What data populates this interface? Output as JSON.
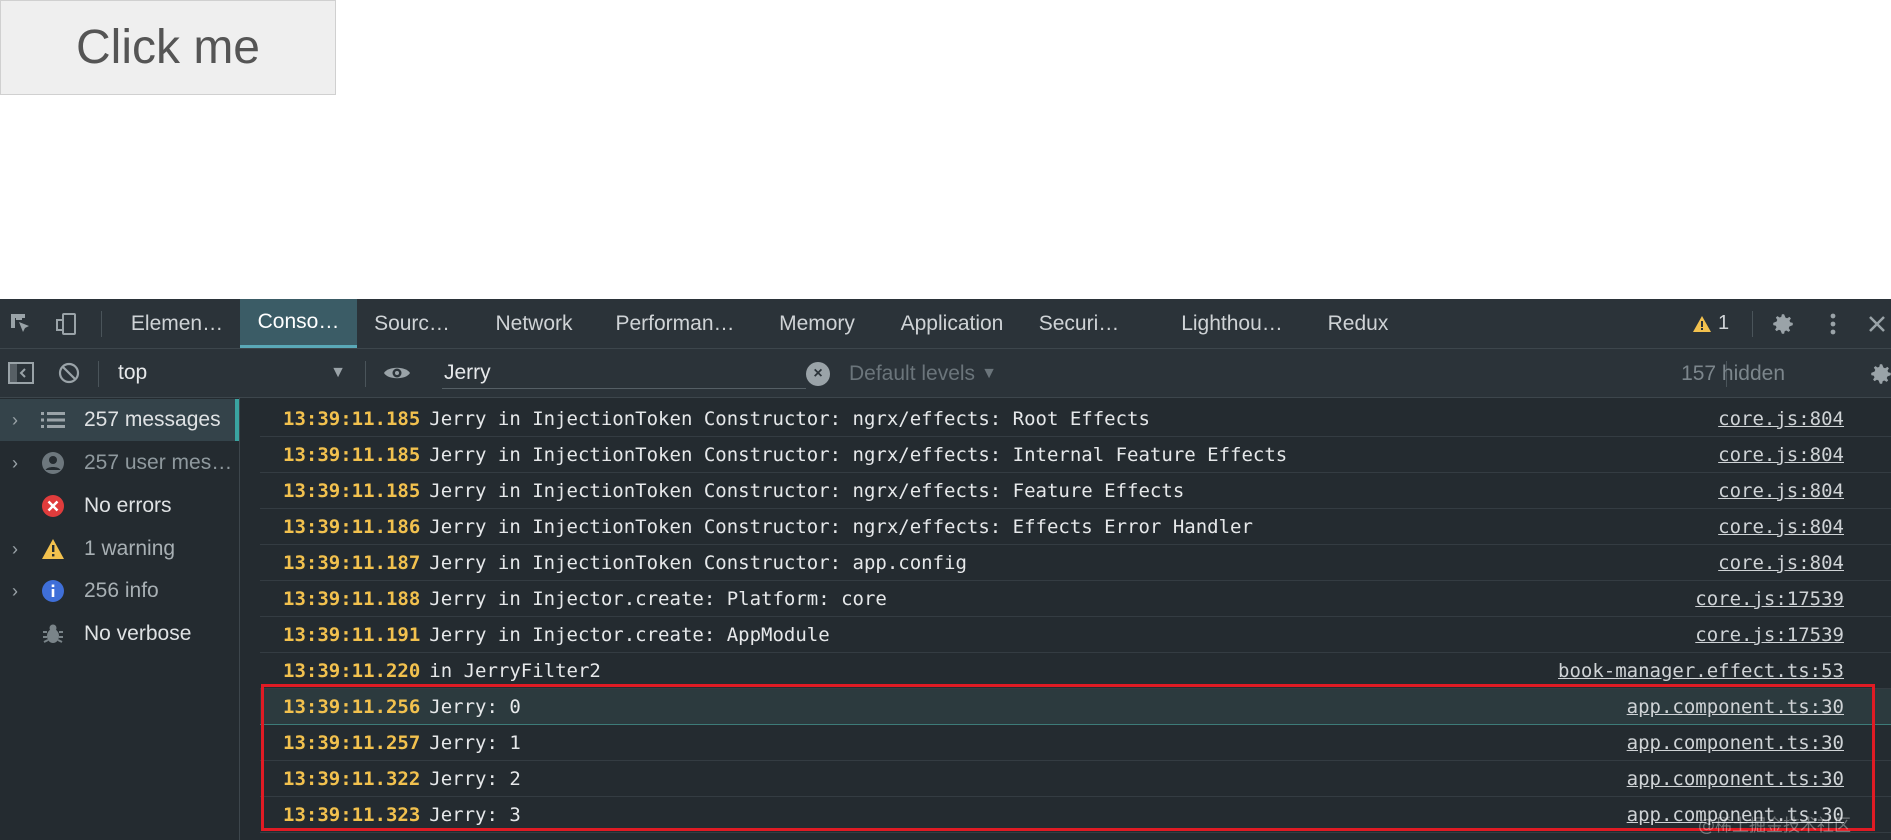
{
  "page": {
    "button_label": "Click me"
  },
  "devtools": {
    "tabs": [
      {
        "label": "Elemen…"
      },
      {
        "label": "Conso…",
        "active": true
      },
      {
        "label": "Sourc…"
      },
      {
        "label": "Network"
      },
      {
        "label": "Performan…"
      },
      {
        "label": "Memory"
      },
      {
        "label": "Application"
      },
      {
        "label": "Securi…"
      },
      {
        "label": "Lighthou…"
      },
      {
        "label": "Redux"
      }
    ],
    "warning_count": "1",
    "toolbar": {
      "context": "top",
      "filter_value": "Jerry",
      "levels": "Default levels",
      "hidden": "157 hidden"
    },
    "sidebar": [
      {
        "label": "257 messages",
        "icon": "list-icon"
      },
      {
        "label": "257 user mess…",
        "icon": "user-icon"
      },
      {
        "label": "No errors",
        "icon": "error-icon"
      },
      {
        "label": "1 warning",
        "icon": "warning-icon"
      },
      {
        "label": "256 info",
        "icon": "info-icon"
      },
      {
        "label": "No verbose",
        "icon": "bug-icon"
      }
    ],
    "logs": [
      {
        "ts": "13:39:11.185",
        "msg": "Jerry in InjectionToken Constructor: ngrx/effects: Root Effects",
        "src": "core.js:804"
      },
      {
        "ts": "13:39:11.185",
        "msg": "Jerry in InjectionToken Constructor: ngrx/effects: Internal Feature Effects",
        "src": "core.js:804"
      },
      {
        "ts": "13:39:11.185",
        "msg": "Jerry in InjectionToken Constructor: ngrx/effects: Feature Effects",
        "src": "core.js:804"
      },
      {
        "ts": "13:39:11.186",
        "msg": "Jerry in InjectionToken Constructor: ngrx/effects: Effects Error Handler",
        "src": "core.js:804"
      },
      {
        "ts": "13:39:11.187",
        "msg": "Jerry in InjectionToken Constructor: app.config",
        "src": "core.js:804"
      },
      {
        "ts": "13:39:11.188",
        "msg": "Jerry in Injector.create: Platform: core",
        "src": "core.js:17539"
      },
      {
        "ts": "13:39:11.191",
        "msg": "Jerry in Injector.create: AppModule",
        "src": "core.js:17539"
      },
      {
        "ts": "13:39:11.220",
        "msg": "in JerryFilter2",
        "src": "book-manager.effect.ts:53"
      },
      {
        "ts": "13:39:11.256",
        "msg": "Jerry: 0",
        "src": "app.component.ts:30"
      },
      {
        "ts": "13:39:11.257",
        "msg": "Jerry: 1",
        "src": "app.component.ts:30"
      },
      {
        "ts": "13:39:11.322",
        "msg": "Jerry: 2",
        "src": "app.component.ts:30"
      },
      {
        "ts": "13:39:11.323",
        "msg": "Jerry: 3",
        "src": "app.component.ts:30"
      }
    ]
  },
  "watermark": "@稀土掘金技术社区",
  "colors": {
    "accent": "#3aa3a0",
    "timestamp": "#f2c14e",
    "highlight_box": "#e01b24"
  }
}
